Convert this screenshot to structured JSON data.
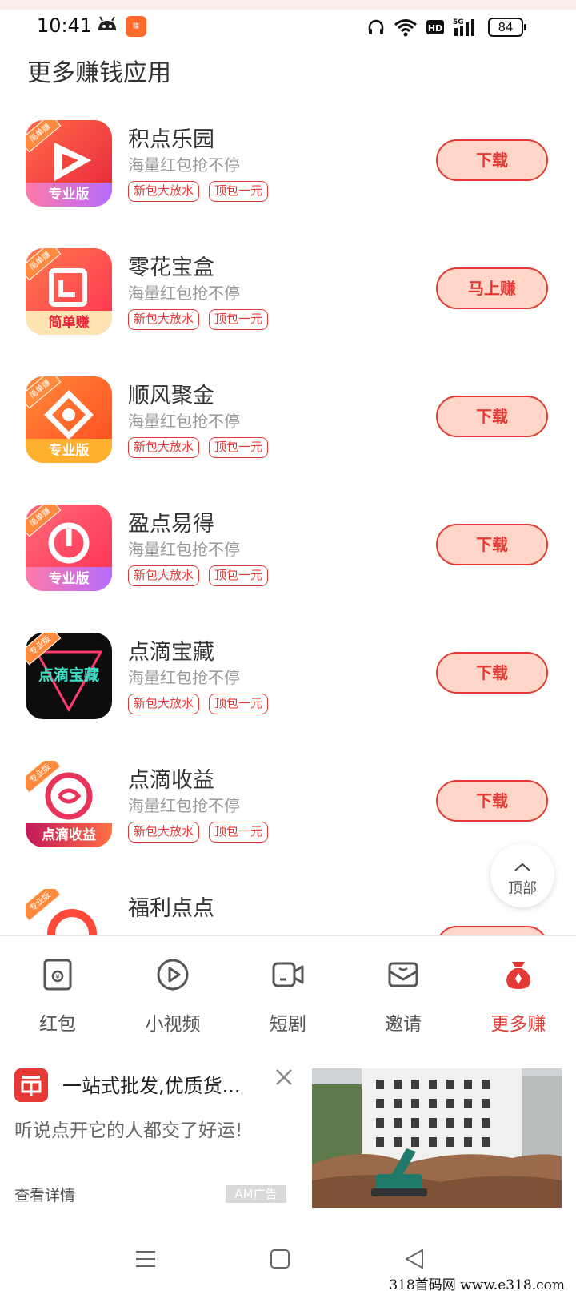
{
  "status_bar": {
    "time": "10:41",
    "battery": "84",
    "icons": [
      "app-robot-icon",
      "app-orange-icon",
      "headphones-icon",
      "wifi-icon",
      "hd-icon",
      "signal-5g-icon",
      "battery-icon"
    ]
  },
  "section_title": "更多赚钱应用",
  "apps": [
    {
      "name": "积点乐园",
      "sub": "海量红包抢不停",
      "tags": [
        "新包大放水",
        "顶包一元"
      ],
      "button": "下载",
      "badge": "简单赚",
      "band": "专业版",
      "color": "#f2453a"
    },
    {
      "name": "零花宝盒",
      "sub": "海量红包抢不停",
      "tags": [
        "新包大放水",
        "顶包一元"
      ],
      "button": "马上赚",
      "badge": "简单赚",
      "band": "简单赚",
      "color": "#ff4d3d"
    },
    {
      "name": "顺风聚金",
      "sub": "海量红包抢不停",
      "tags": [
        "新包大放水",
        "顶包一元"
      ],
      "button": "下载",
      "badge": "简单赚",
      "band": "专业版",
      "color": "#ff6e2a"
    },
    {
      "name": "盈点易得",
      "sub": "海量红包抢不停",
      "tags": [
        "新包大放水",
        "顶包一元"
      ],
      "button": "下载",
      "badge": "简单赚",
      "band": "专业版",
      "color": "#ff4a5a"
    },
    {
      "name": "点滴宝藏",
      "sub": "海量红包抢不停",
      "tags": [
        "新包大放水",
        "顶包一元"
      ],
      "button": "下载",
      "badge": "专业版",
      "band": "点滴宝藏",
      "color": "#111111"
    },
    {
      "name": "点滴收益",
      "sub": "海量红包抢不停",
      "tags": [
        "新包大放水",
        "顶包一元"
      ],
      "button": "下载",
      "badge": "专业版",
      "band": "点滴收益",
      "color": "#ffffff"
    },
    {
      "name": "福利点点",
      "sub": "",
      "tags": [],
      "button": "",
      "badge": "专业版",
      "band": "",
      "color": "#ffffff"
    }
  ],
  "back_to_top": "顶部",
  "tabs": [
    {
      "label": "红包",
      "icon": "red-envelope-icon",
      "active": false
    },
    {
      "label": "小视频",
      "icon": "play-icon",
      "active": false
    },
    {
      "label": "短剧",
      "icon": "video-camera-icon",
      "active": false
    },
    {
      "label": "邀请",
      "icon": "envelope-icon",
      "active": false
    },
    {
      "label": "更多赚",
      "icon": "money-bag-icon",
      "active": true
    }
  ],
  "ad": {
    "title": "一站式批发,优质货...",
    "desc": "听说点开它的人都交了好运!",
    "more": "查看详情",
    "badge": "AM广告"
  },
  "watermark": "318首码网 www.e318.com",
  "colors": {
    "accent": "#e53935",
    "button_bg": "#ffd6c8"
  }
}
